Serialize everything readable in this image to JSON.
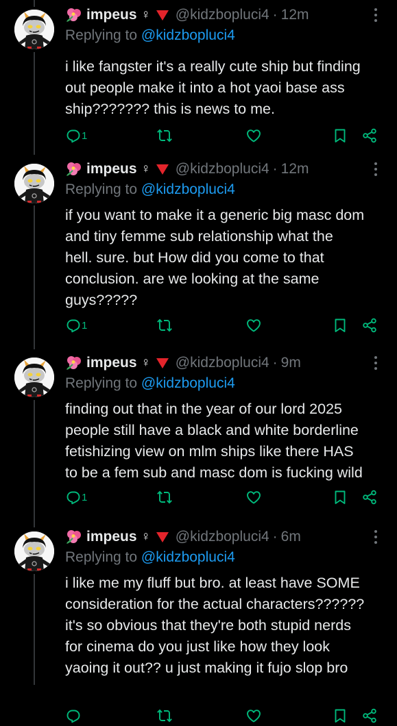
{
  "author": {
    "name": "impeus",
    "symbol": "♀",
    "handle": "@kidzbopluci4",
    "avatar_icon": "homestuck-troll-avatar-icon",
    "flower_icon": "hibiscus-icon"
  },
  "reply_prefix": "Replying to",
  "reply_to": "@kidzbopluci4",
  "colors": {
    "accent_green": "#00ba7c",
    "mention_blue": "#1d9bf0",
    "muted": "#71767b",
    "triangle_red": "#e3242b"
  },
  "posts": [
    {
      "time": "12m",
      "lines": [
        "i like fangster it's a really cute ship but finding",
        "out people make it into a hot yaoi base ass",
        "ship??????? this is news to me."
      ],
      "reply_count": "1"
    },
    {
      "time": "12m",
      "lines": [
        "if you want to make it a generic big masc dom",
        "and tiny femme sub relationship what the",
        "hell. sure. but How did you come to that",
        "conclusion. are we looking at the same",
        "guys?????"
      ],
      "reply_count": "1"
    },
    {
      "time": "9m",
      "lines": [
        "finding out that in the year of our lord 2025",
        "people still have a black and white borderline",
        "fetishizing view on mlm ships like there HAS",
        "to be a fem sub and masc dom is fucking wild"
      ],
      "reply_count": "1"
    },
    {
      "time": "6m",
      "lines": [
        "i like me my fluff but bro. at least have SOME",
        "consideration for the actual characters??????",
        "it's so obvious that they're both stupid nerds",
        "for cinema do you just like how they look",
        "yaoing it out?? u just making it fujo slop bro"
      ],
      "reply_count": ""
    }
  ]
}
